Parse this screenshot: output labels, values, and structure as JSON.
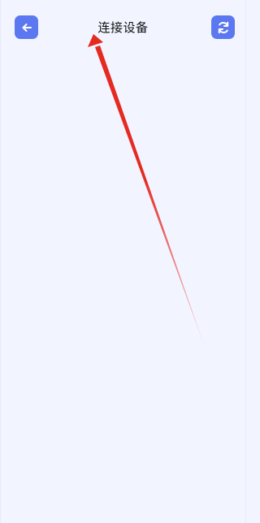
{
  "header": {
    "title": "连接设备",
    "back_button": {
      "icon": "arrow-left-icon",
      "label": ""
    },
    "refresh_button": {
      "icon": "refresh-icon",
      "label": ""
    }
  },
  "colors": {
    "background": "#f2f5ff",
    "accent": "#5b78f0",
    "annotation_arrow": "#e52a21"
  }
}
